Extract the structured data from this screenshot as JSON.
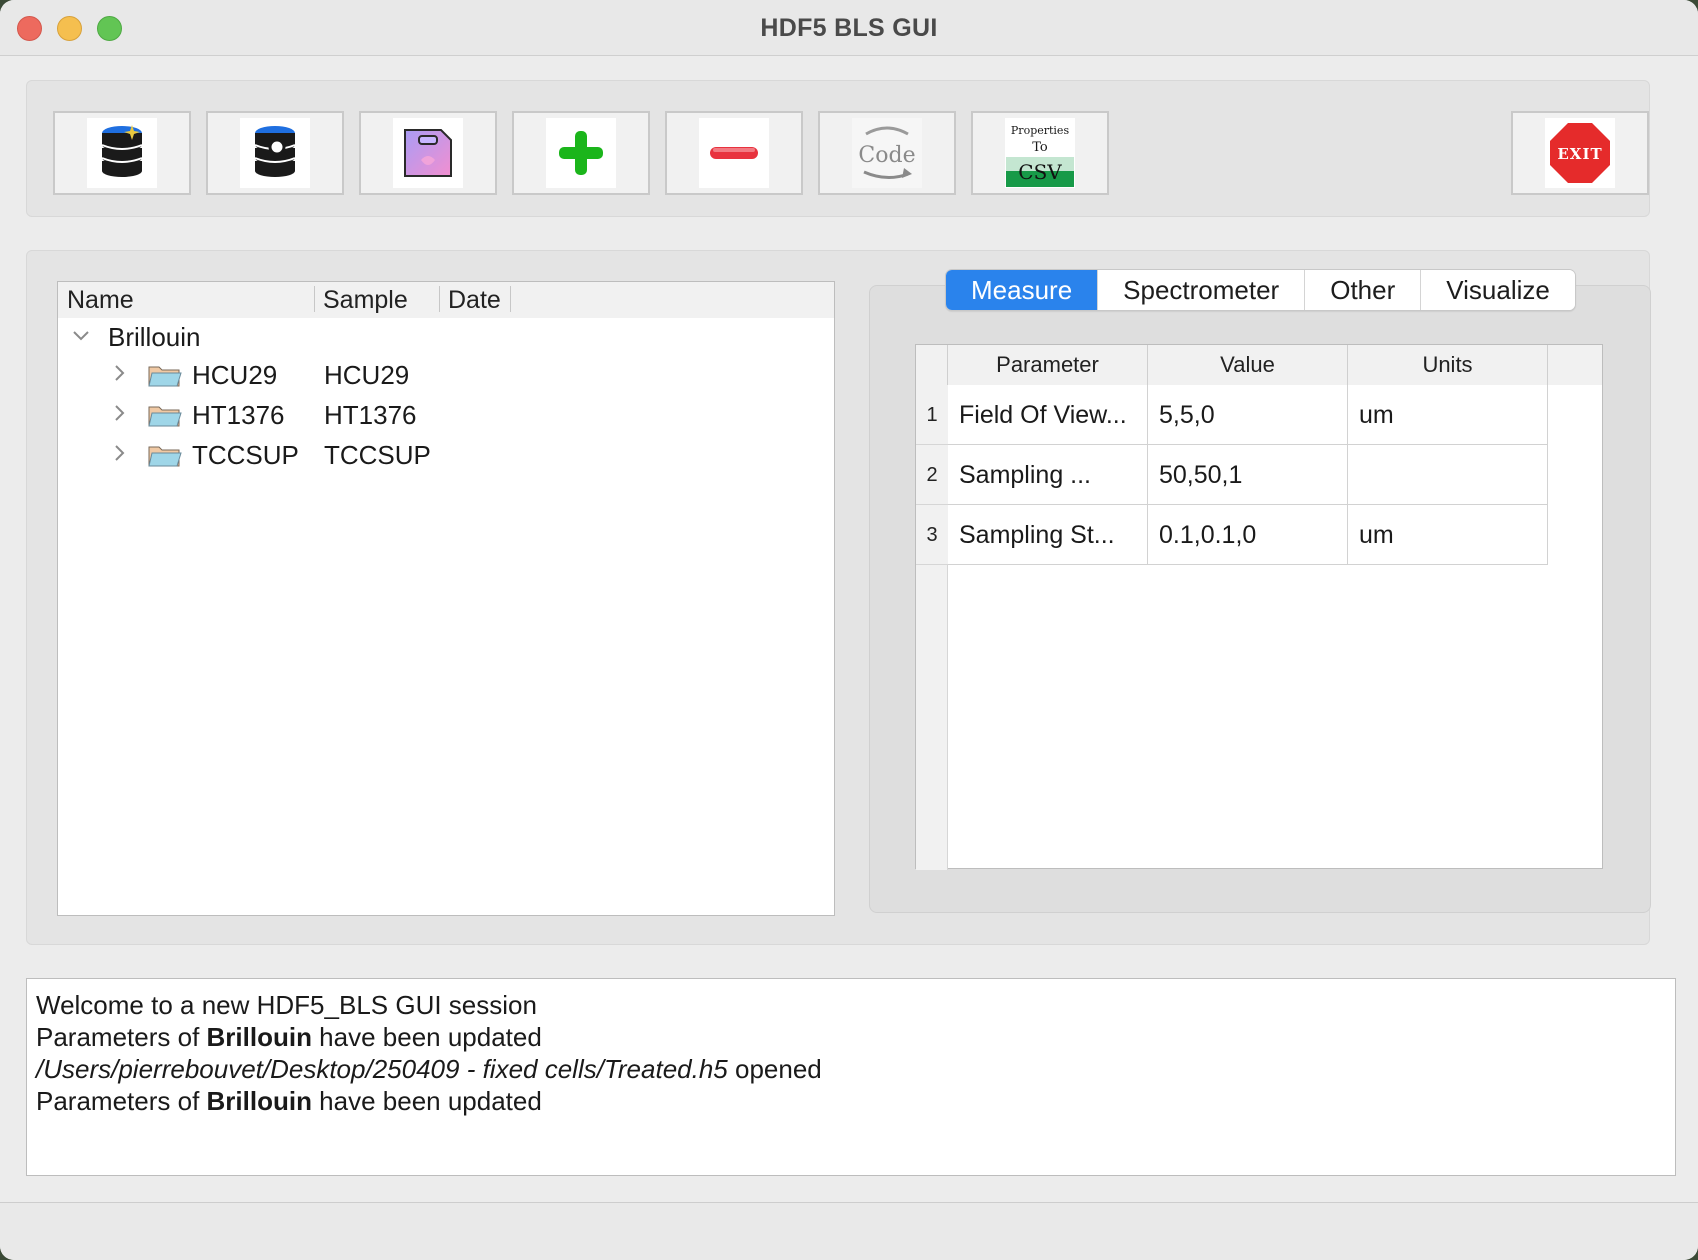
{
  "window": {
    "title": "HDF5 BLS GUI"
  },
  "toolbar": {
    "buttons": [
      {
        "name": "new-file",
        "icon": "database-new-icon"
      },
      {
        "name": "open-file",
        "icon": "database-search-icon"
      },
      {
        "name": "save-file",
        "icon": "save-bag-icon"
      },
      {
        "name": "add",
        "icon": "plus-icon"
      },
      {
        "name": "remove",
        "icon": "minus-icon"
      },
      {
        "name": "export-code",
        "icon": "code-arrow-icon",
        "label": "Code"
      },
      {
        "name": "properties-to-csv",
        "icon": "csv-export-icon",
        "label_line1": "Properties",
        "label_line2": "To",
        "label_line3": "CSV"
      },
      {
        "name": "exit",
        "icon": "exit-stop-icon",
        "label": "EXIT"
      }
    ]
  },
  "tree": {
    "columns": [
      "Name",
      "Sample",
      "Date"
    ],
    "root": {
      "name": "Brillouin"
    },
    "children": [
      {
        "name": "HCU29",
        "sample": "HCU29"
      },
      {
        "name": "HT1376",
        "sample": "HT1376"
      },
      {
        "name": "TCCSUP",
        "sample": "TCCSUP"
      }
    ]
  },
  "tabs": {
    "items": [
      "Measure",
      "Spectrometer",
      "Other",
      "Visualize"
    ],
    "active": "Measure"
  },
  "params": {
    "columns": [
      "Parameter",
      "Value",
      "Units"
    ],
    "rows": [
      {
        "num": "1",
        "parameter": "Field Of View...",
        "value": "5,5,0",
        "units": "um"
      },
      {
        "num": "2",
        "parameter": "Sampling ...",
        "value": "50,50,1",
        "units": ""
      },
      {
        "num": "3",
        "parameter": "Sampling St...",
        "value": "0.1,0.1,0",
        "units": "um"
      }
    ]
  },
  "log": {
    "line1": "Welcome to a new HDF5_BLS GUI session",
    "line2_pre": "Parameters of ",
    "line2_bold": "Brillouin",
    "line2_post": " have been updated",
    "line3_italic": "/Users/pierrebouvet/Desktop/250409 - fixed cells/Treated.h5",
    "line3_post": " opened",
    "line4_pre": "Parameters of ",
    "line4_bold": "Brillouin",
    "line4_post": " have been updated"
  },
  "colors": {
    "accent": "#2a83ec",
    "plus": "#1bb51b",
    "minus": "#e8323e",
    "exit": "#e52b2b"
  }
}
